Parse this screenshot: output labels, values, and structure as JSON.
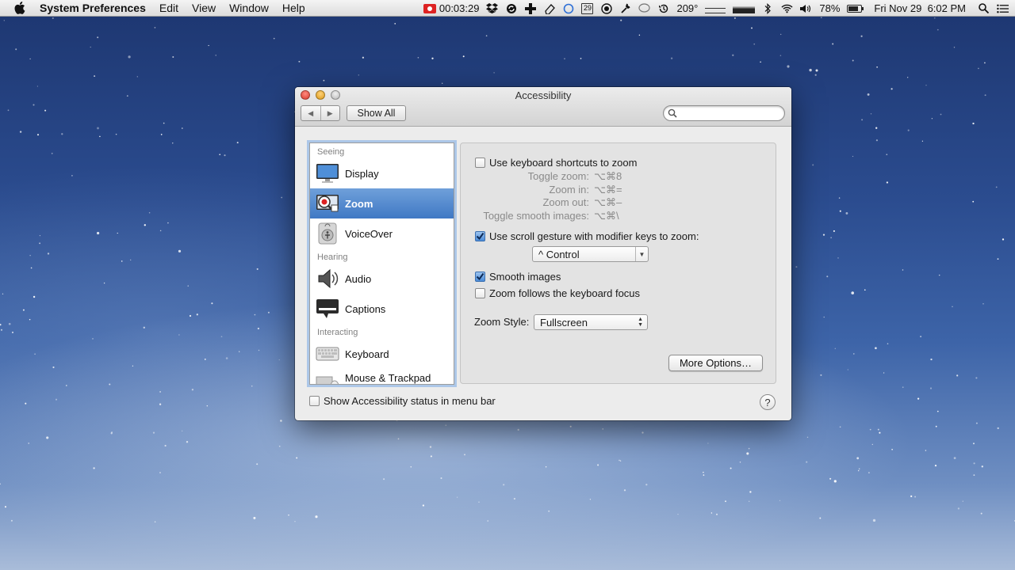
{
  "menubar": {
    "app_name": "System Preferences",
    "menus": [
      "Edit",
      "View",
      "Window",
      "Help"
    ],
    "recording_time": "00:03:29",
    "calendar_day": "29",
    "temperature": "209°",
    "battery_percent": "78%",
    "clock": "Fri Nov 29  6:02 PM"
  },
  "window": {
    "title": "Accessibility",
    "show_all_label": "Show All",
    "search_placeholder": ""
  },
  "sidebar": {
    "sections": [
      {
        "header": "Seeing",
        "items": [
          {
            "label": "Display",
            "icon": "display-icon"
          },
          {
            "label": "Zoom",
            "icon": "zoom-icon",
            "selected": true
          },
          {
            "label": "VoiceOver",
            "icon": "voiceover-icon"
          }
        ]
      },
      {
        "header": "Hearing",
        "items": [
          {
            "label": "Audio",
            "icon": "speaker-icon"
          },
          {
            "label": "Captions",
            "icon": "captions-icon"
          }
        ]
      },
      {
        "header": "Interacting",
        "items": [
          {
            "label": "Keyboard",
            "icon": "keyboard-icon"
          },
          {
            "label": "Mouse & Trackpad",
            "icon": "mouse-icon"
          }
        ]
      }
    ]
  },
  "zoom": {
    "keyboard_shortcuts_label": "Use keyboard shortcuts to zoom",
    "keyboard_shortcuts_checked": false,
    "shortcuts": [
      {
        "label": "Toggle zoom:",
        "keys": "⌥⌘8"
      },
      {
        "label": "Zoom in:",
        "keys": "⌥⌘="
      },
      {
        "label": "Zoom out:",
        "keys": "⌥⌘–"
      },
      {
        "label": "Toggle smooth images:",
        "keys": "⌥⌘\\"
      }
    ],
    "scroll_gesture_label": "Use scroll gesture with modifier keys to zoom:",
    "scroll_gesture_checked": true,
    "modifier_value": "^ Control",
    "smooth_images_label": "Smooth images",
    "smooth_images_checked": true,
    "follow_focus_label": "Zoom follows the keyboard focus",
    "follow_focus_checked": false,
    "zoom_style_label": "Zoom Style:",
    "zoom_style_value": "Fullscreen",
    "more_options_label": "More Options…"
  },
  "footer": {
    "status_label": "Show Accessibility status in menu bar",
    "status_checked": false,
    "help_label": "?"
  },
  "colors": {
    "selection": "#3f78c4",
    "checkbox_checked": "#4a8ad6",
    "close": "#d8392c",
    "minimize": "#dc9a18"
  }
}
